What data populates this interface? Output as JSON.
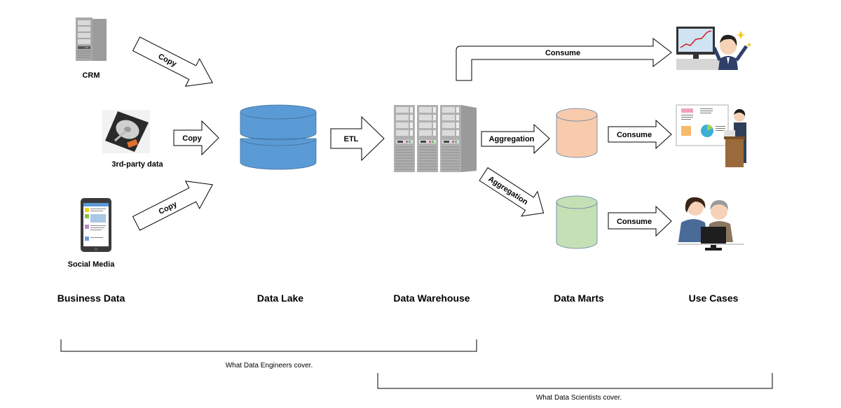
{
  "sources": [
    {
      "label": "CRM",
      "icon": "server-rack-icon"
    },
    {
      "label": "3rd-party data",
      "icon": "hard-drive-icon"
    },
    {
      "label": "Social Media",
      "icon": "smartphone-icon"
    }
  ],
  "arrows": {
    "crm_copy": "Copy",
    "thirdparty_copy": "Copy",
    "social_copy": "Copy",
    "etl": "ETL",
    "direct_consume": "Consume",
    "aggregation_1": "Aggregation",
    "aggregation_2": "Aggregation",
    "mart1_consume": "Consume",
    "mart2_consume": "Consume"
  },
  "stages": {
    "business_data": "Business Data",
    "data_lake": "Data Lake",
    "data_warehouse": "Data Warehouse",
    "data_marts": "Data Marts",
    "use_cases": "Use Cases"
  },
  "coverage": {
    "engineers": "What Data Engineers cover.",
    "scientists": "What Data Scientists cover."
  },
  "colors": {
    "data_lake": "#5B9BD5",
    "data_lake_stroke": "#41719C",
    "mart_orange": "#F8CBAD",
    "mart_green": "#C5E0B4",
    "mart_stroke": "#5B7FA6",
    "server_gray": "#9a9a9a"
  },
  "use_cases": [
    {
      "icon": "stock-chart-celebration-icon"
    },
    {
      "icon": "presentation-icon"
    },
    {
      "icon": "consultation-computer-icon"
    }
  ]
}
